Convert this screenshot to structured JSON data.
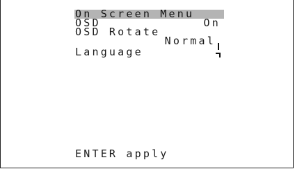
{
  "osd": {
    "title": "On Screen Menu",
    "osd_label": "OSD",
    "osd_value": "On",
    "rotate_label": "OSD Rotate",
    "rotate_value": "Normal",
    "language_label": "Language",
    "footer": "ENTER apply"
  },
  "colors": {
    "title_highlight": "#b4b4b4",
    "text": "#1a1a1a",
    "background": "#ffffff"
  },
  "icons": {
    "selection_cursor": "cursor-bracket-icon"
  }
}
